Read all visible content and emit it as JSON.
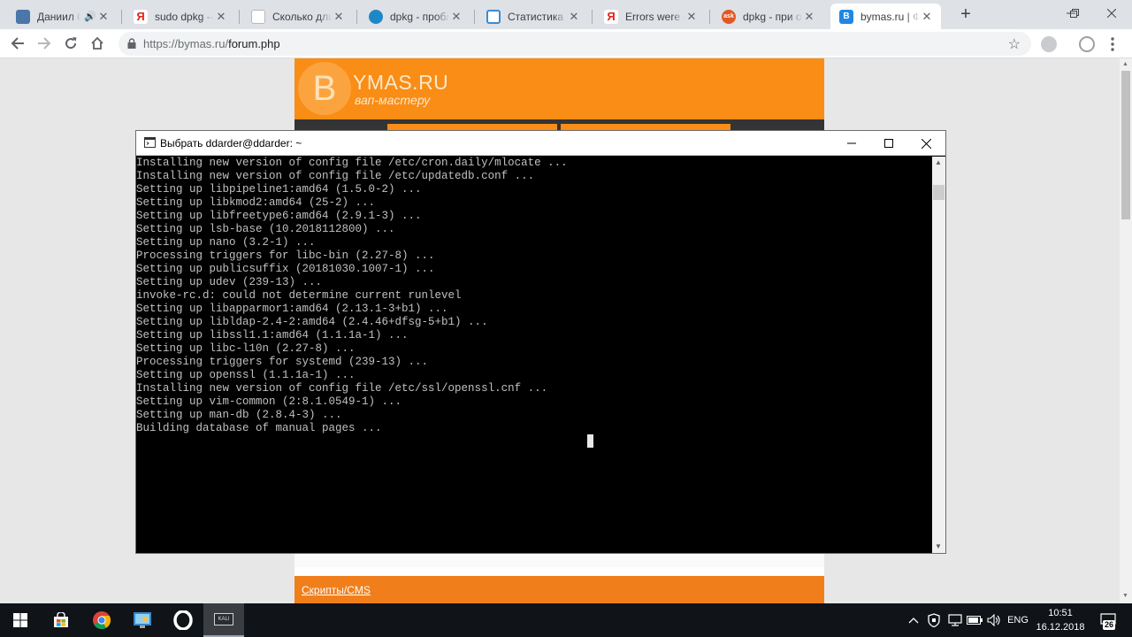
{
  "browser": {
    "tabs": [
      {
        "title": "Даниил Су",
        "favicon": "vk-icon",
        "color": "#4a76a8",
        "glyph": "",
        "speaker": true
      },
      {
        "title": "sudo dpkg --co",
        "favicon": "yandex-icon",
        "color": "#ffffff",
        "glyph": "Я"
      },
      {
        "title": "Сколько длиться",
        "favicon": "doc-icon",
        "color": "#ffffff",
        "glyph": ""
      },
      {
        "title": "dpkg - проблем",
        "favicon": "gear-icon",
        "color": "#1e88c7",
        "glyph": ""
      },
      {
        "title": "Статистика пла",
        "favicon": "chart-icon",
        "color": "#ffffff",
        "glyph": ""
      },
      {
        "title": "Errors were enc",
        "favicon": "yandex-icon",
        "color": "#ffffff",
        "glyph": "Я"
      },
      {
        "title": "dpkg - при об",
        "favicon": "ask-icon",
        "color": "#e25822",
        "glyph": "ask"
      },
      {
        "title": "bymas.ru | Фор",
        "favicon": "bymas-icon",
        "color": "#1e88e5",
        "glyph": "B"
      }
    ],
    "active_tab": 7,
    "url_host": "https://bymas.ru/",
    "url_path": "forum.php",
    "new_tab_label": "+"
  },
  "site": {
    "logo_letter": "B",
    "logo_rest": "YMAS.RU",
    "tagline": "вап-мастеру",
    "bottom_link": "Скрипты/CMS",
    "colors": {
      "header": "#f98d16",
      "nav": "#343434",
      "bar": "#f07f1b"
    }
  },
  "terminal": {
    "title": "Выбрать ddarder@ddarder: ~",
    "lines": [
      "Installing new version of config file /etc/cron.daily/mlocate ...",
      "Installing new version of config file /etc/updatedb.conf ...",
      "Setting up libpipeline1:amd64 (1.5.0-2) ...",
      "Setting up libkmod2:amd64 (25-2) ...",
      "Setting up libfreetype6:amd64 (2.9.1-3) ...",
      "Setting up lsb-base (10.2018112800) ...",
      "Setting up nano (3.2-1) ...",
      "Processing triggers for libc-bin (2.27-8) ...",
      "Setting up publicsuffix (20181030.1007-1) ...",
      "Setting up udev (239-13) ...",
      "invoke-rc.d: could not determine current runlevel",
      "Setting up libapparmor1:amd64 (2.13.1-3+b1) ...",
      "Setting up libldap-2.4-2:amd64 (2.4.46+dfsg-5+b1) ...",
      "Setting up libssl1.1:amd64 (1.1.1a-1) ...",
      "Setting up libc-l10n (2.27-8) ...",
      "Processing triggers for systemd (239-13) ...",
      "Setting up openssl (1.1.1a-1) ...",
      "Installing new version of config file /etc/ssl/openssl.cnf ...",
      "Setting up vim-common (2:8.1.0549-1) ...",
      "Setting up man-db (2.8.4-3) ...",
      "Building database of manual pages ..."
    ]
  },
  "taskbar": {
    "apps": [
      "windows-start-icon",
      "store-icon",
      "chrome-icon",
      "control-panel-icon",
      "opera-icon",
      "kali-terminal-icon"
    ],
    "kali_label": "KALI",
    "lang": "ENG",
    "time": "10:51",
    "date": "16.12.2018",
    "notifications": "26"
  }
}
